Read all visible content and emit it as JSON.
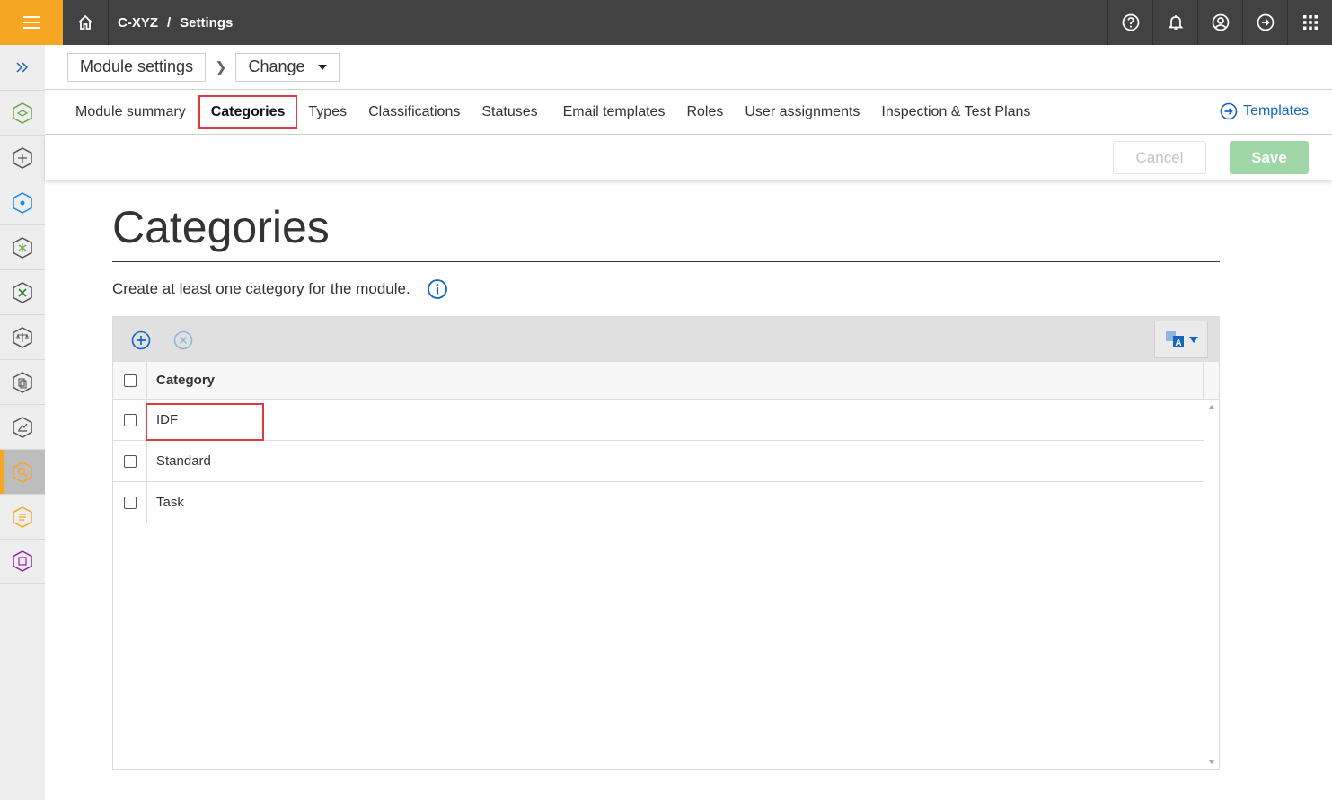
{
  "header": {
    "breadcrumb": [
      "C-XYZ",
      "/",
      "Settings"
    ],
    "icons": [
      "menu-icon",
      "home-icon",
      "help-icon",
      "bell-icon",
      "user-icon",
      "logout-icon",
      "apps-grid-icon"
    ]
  },
  "module_selector": {
    "module_label": "Module settings",
    "change_label": "Change"
  },
  "tabs": [
    {
      "label": "Module summary"
    },
    {
      "label": "Categories"
    },
    {
      "label": "Types"
    },
    {
      "label": "Classifications"
    },
    {
      "label": "Statuses"
    },
    {
      "label": "Email templates"
    },
    {
      "label": "Roles"
    },
    {
      "label": "User assignments"
    },
    {
      "label": "Inspection & Test Plans"
    }
  ],
  "active_tab": "Categories",
  "templates_link": "Templates",
  "actions": {
    "cancel_label": "Cancel",
    "save_label": "Save"
  },
  "page": {
    "title": "Categories",
    "subtitle": "Create at least one category for the module."
  },
  "grid": {
    "column_header": "Category",
    "rows": [
      {
        "label": "IDF",
        "checked": false
      },
      {
        "label": "Standard",
        "checked": false
      },
      {
        "label": "Task",
        "checked": false
      }
    ]
  },
  "colors": {
    "topbar": "#424242",
    "accent": "#f5a623",
    "link": "#1565c0",
    "highlight": "#e0393e",
    "save": "#9ed6a6"
  }
}
